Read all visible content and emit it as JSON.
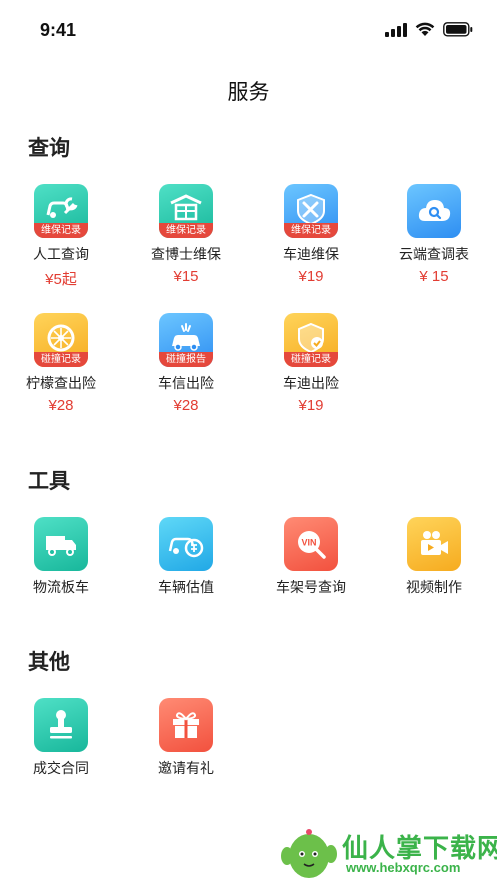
{
  "status_bar": {
    "time": "9:41"
  },
  "page": {
    "title": "服务"
  },
  "sections": [
    {
      "title": "查询",
      "items": [
        {
          "label": "人工查询",
          "price": "¥5起",
          "tag": "维保记录",
          "icon": "wrench-car-icon"
        },
        {
          "label": "查博士维保",
          "price": "¥15",
          "tag": "维保记录",
          "icon": "garage-icon"
        },
        {
          "label": "车迪维保",
          "price": "¥19",
          "tag": "维保记录",
          "icon": "tools-shield-icon"
        },
        {
          "label": "云端查调表",
          "price": "¥ 15",
          "tag": "",
          "icon": "cloud-search-icon"
        },
        {
          "label": "柠檬查出险",
          "price": "¥28",
          "tag": "碰撞记录",
          "icon": "lemon-icon"
        },
        {
          "label": "车信出险",
          "price": "¥28",
          "tag": "碰撞报告",
          "icon": "car-crash-icon"
        },
        {
          "label": "车迪出险",
          "price": "¥19",
          "tag": "碰撞记录",
          "icon": "shield-check-icon"
        }
      ]
    },
    {
      "title": "工具",
      "items": [
        {
          "label": "物流板车",
          "icon": "truck-icon"
        },
        {
          "label": "车辆估值",
          "icon": "car-valuation-icon"
        },
        {
          "label": "车架号查询",
          "icon": "vin-search-icon"
        },
        {
          "label": "视频制作",
          "icon": "video-camera-icon"
        }
      ]
    },
    {
      "title": "其他",
      "items": [
        {
          "label": "成交合同",
          "icon": "stamp-icon"
        },
        {
          "label": "邀请有礼",
          "icon": "gift-icon"
        }
      ]
    }
  ],
  "watermark": {
    "text": "仙人掌下载网",
    "url": "www.hebxqrc.com"
  },
  "colors": {
    "price": "#e23d33",
    "tag": "#e5483c",
    "teal": "#1fbfa2",
    "blue": "#2e8ef2",
    "yellow": "#f6ab1f",
    "red": "#f2513e"
  }
}
